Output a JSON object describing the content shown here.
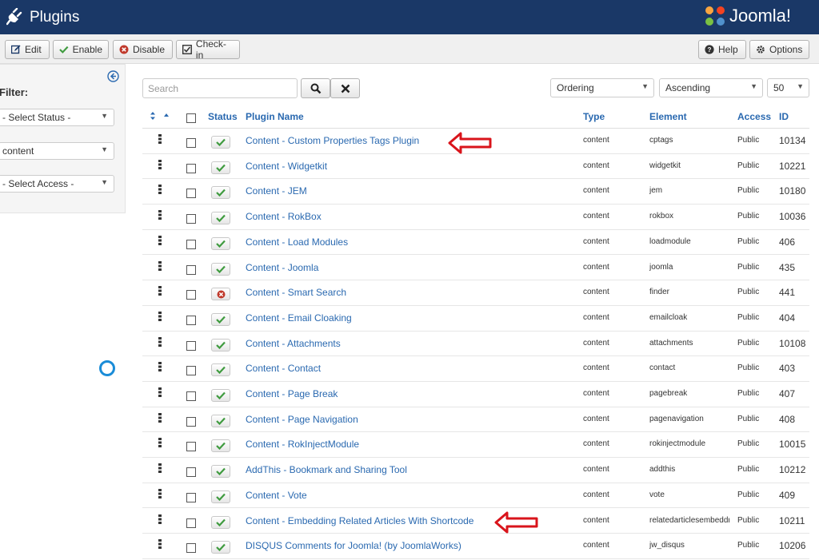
{
  "header": {
    "title": "Plugins",
    "logo_text": "Joomla!"
  },
  "toolbar": {
    "edit": "Edit",
    "enable": "Enable",
    "disable": "Disable",
    "checkin": "Check-in",
    "help": "Help",
    "options": "Options"
  },
  "sidebar": {
    "filter_label": "Filter:",
    "status_select": "- Select Status -",
    "type_select": "content",
    "access_select": "- Select Access -"
  },
  "search": {
    "placeholder": "Search"
  },
  "list_controls": {
    "ordering": "Ordering",
    "direction": "Ascending",
    "limit": "50"
  },
  "table": {
    "headers": {
      "status": "Status",
      "name": "Plugin Name",
      "type": "Type",
      "element": "Element",
      "access": "Access",
      "id": "ID"
    },
    "rows": [
      {
        "name": "Content - Custom Properties Tags Plugin",
        "enabled": true,
        "type": "content",
        "element": "cptags",
        "access": "Public",
        "id": "10134"
      },
      {
        "name": "Content - Widgetkit",
        "enabled": true,
        "type": "content",
        "element": "widgetkit",
        "access": "Public",
        "id": "10221"
      },
      {
        "name": "Content - JEM",
        "enabled": true,
        "type": "content",
        "element": "jem",
        "access": "Public",
        "id": "10180"
      },
      {
        "name": "Content - RokBox",
        "enabled": true,
        "type": "content",
        "element": "rokbox",
        "access": "Public",
        "id": "10036"
      },
      {
        "name": "Content - Load Modules",
        "enabled": true,
        "type": "content",
        "element": "loadmodule",
        "access": "Public",
        "id": "406"
      },
      {
        "name": "Content - Joomla",
        "enabled": true,
        "type": "content",
        "element": "joomla",
        "access": "Public",
        "id": "435"
      },
      {
        "name": "Content - Smart Search",
        "enabled": false,
        "type": "content",
        "element": "finder",
        "access": "Public",
        "id": "441"
      },
      {
        "name": "Content - Email Cloaking",
        "enabled": true,
        "type": "content",
        "element": "emailcloak",
        "access": "Public",
        "id": "404"
      },
      {
        "name": "Content - Attachments",
        "enabled": true,
        "type": "content",
        "element": "attachments",
        "access": "Public",
        "id": "10108"
      },
      {
        "name": "Content - Contact",
        "enabled": true,
        "type": "content",
        "element": "contact",
        "access": "Public",
        "id": "403"
      },
      {
        "name": "Content - Page Break",
        "enabled": true,
        "type": "content",
        "element": "pagebreak",
        "access": "Public",
        "id": "407"
      },
      {
        "name": "Content - Page Navigation",
        "enabled": true,
        "type": "content",
        "element": "pagenavigation",
        "access": "Public",
        "id": "408"
      },
      {
        "name": "Content - RokInjectModule",
        "enabled": true,
        "type": "content",
        "element": "rokinjectmodule",
        "access": "Public",
        "id": "10015"
      },
      {
        "name": "AddThis - Bookmark and Sharing Tool",
        "enabled": true,
        "type": "content",
        "element": "addthis",
        "access": "Public",
        "id": "10212"
      },
      {
        "name": "Content - Vote",
        "enabled": true,
        "type": "content",
        "element": "vote",
        "access": "Public",
        "id": "409"
      },
      {
        "name": "Content - Embedding Related Articles With Shortcode",
        "enabled": true,
        "type": "content",
        "element": "relatedarticlesembeddr",
        "access": "Public",
        "id": "10211"
      },
      {
        "name": "DISQUS Comments for Joomla! (by JoomlaWorks)",
        "enabled": true,
        "type": "content",
        "element": "jw_disqus",
        "access": "Public",
        "id": "10206"
      }
    ]
  },
  "colors": {
    "header_bg": "#1a3867",
    "link": "#2a69b0",
    "annotation_arrow": "#d9141b",
    "enabled_check": "#3f9b3f",
    "disabled_x": "#c0392b"
  }
}
